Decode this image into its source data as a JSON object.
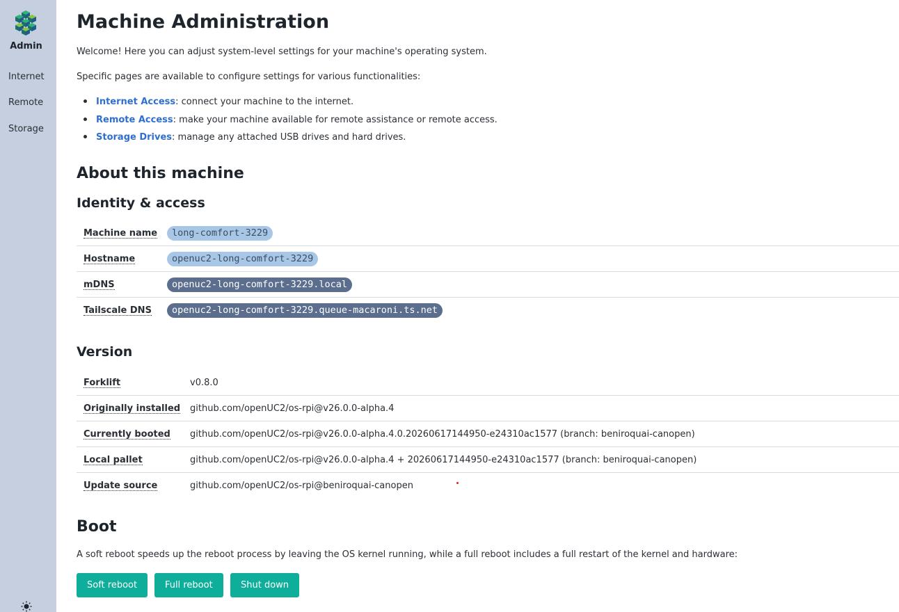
{
  "sidebar": {
    "brand": "Admin",
    "items": [
      {
        "label": "Internet"
      },
      {
        "label": "Remote"
      },
      {
        "label": "Storage"
      }
    ]
  },
  "page": {
    "title": "Machine Administration",
    "welcome": "Welcome! Here you can adjust system-level settings for your machine's operating system.",
    "intro": "Specific pages are available to configure settings for various functionalities:",
    "links": [
      {
        "label": "Internet Access",
        "desc": ": connect your machine to the internet."
      },
      {
        "label": "Remote Access",
        "desc": ": make your machine available for remote assistance or remote access."
      },
      {
        "label": "Storage Drives",
        "desc": ": manage any attached USB drives and hard drives."
      }
    ]
  },
  "about": {
    "heading": "About this machine",
    "identity_heading": "Identity & access",
    "identity": [
      {
        "key": "Machine name",
        "value": "long-comfort-3229"
      },
      {
        "key": "Hostname",
        "value": "openuc2-long-comfort-3229"
      },
      {
        "key": "mDNS",
        "value": "openuc2-long-comfort-3229.local"
      },
      {
        "key": "Tailscale DNS",
        "value": "openuc2-long-comfort-3229.queue-macaroni.ts.net"
      }
    ],
    "version_heading": "Version",
    "version": [
      {
        "key": "Forklift",
        "value": "v0.8.0"
      },
      {
        "key": "Originally installed",
        "value": "github.com/openUC2/os-rpi@v26.0.0-alpha.4"
      },
      {
        "key": "Currently booted",
        "value": "github.com/openUC2/os-rpi@v26.0.0-alpha.4.0.20260617144950-e24310ac1577 (branch: beniroquai-canopen)"
      },
      {
        "key": "Local pallet",
        "value": "github.com/openUC2/os-rpi@v26.0.0-alpha.4 + 20260617144950-e24310ac1577 (branch: beniroquai-canopen)"
      },
      {
        "key": "Update source",
        "value": "github.com/openUC2/os-rpi@beniroquai-canopen"
      }
    ]
  },
  "boot": {
    "heading": "Boot",
    "desc": "A soft reboot speeds up the reboot process by leaving the OS kernel running, while a full reboot includes a full restart of the kernel and hardware:",
    "buttons": {
      "soft": "Soft reboot",
      "full": "Full reboot",
      "shutdown": "Shut down"
    }
  },
  "colors": {
    "accent": "#0fae9b",
    "link": "#2f6fcf",
    "sidebar": "#c5cfdf",
    "pill_light": "#a8c7e6",
    "pill_dark": "#5b6e8e"
  },
  "icons": {
    "logo": "cube-cluster-logo",
    "theme": "sun-icon"
  }
}
